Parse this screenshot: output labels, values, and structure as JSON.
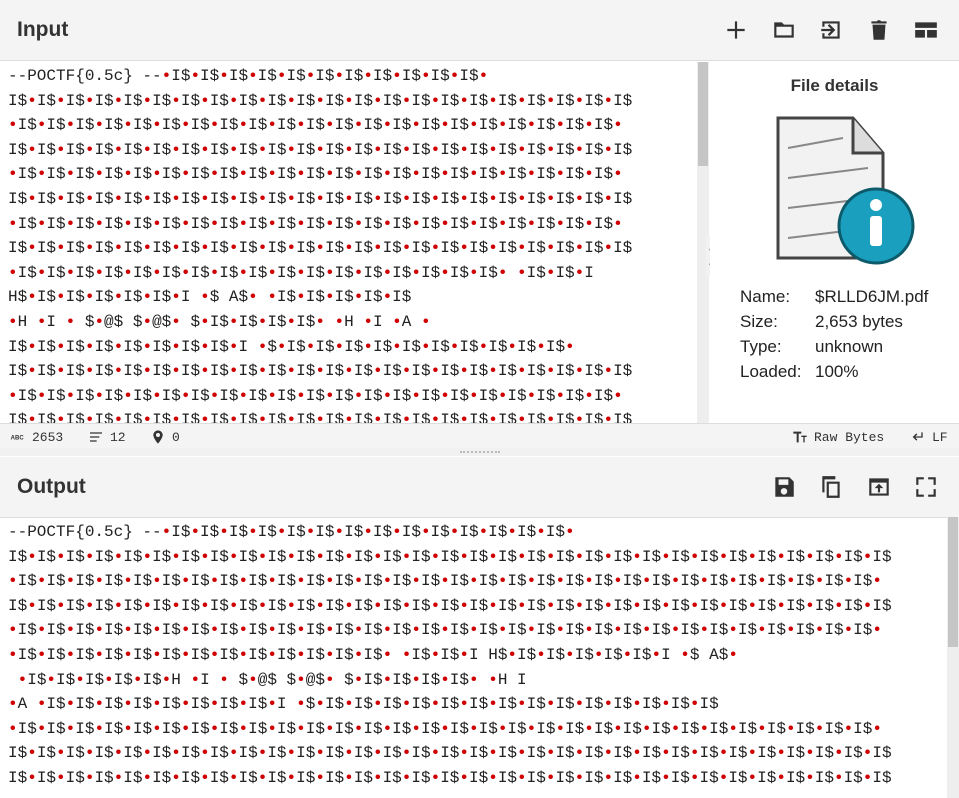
{
  "input": {
    "title": "Input",
    "lines": [
      "--POCTF{0.5c} --•I$•I$•I$•I$•I$•I$•I$•I$•I$•I$•I$•",
      "I$•I$•I$•I$•I$•I$•I$•I$•I$•I$•I$•I$•I$•I$•I$•I$•I$•I$•I$•I$•I$•I$",
      "•I$•I$•I$•I$•I$•I$•I$•I$•I$•I$•I$•I$•I$•I$•I$•I$•I$•I$•I$•I$•I$•",
      "I$•I$•I$•I$•I$•I$•I$•I$•I$•I$•I$•I$•I$•I$•I$•I$•I$•I$•I$•I$•I$•I$",
      "•I$•I$•I$•I$•I$•I$•I$•I$•I$•I$•I$•I$•I$•I$•I$•I$•I$•I$•I$•I$•I$•",
      "I$•I$•I$•I$•I$•I$•I$•I$•I$•I$•I$•I$•I$•I$•I$•I$•I$•I$•I$•I$•I$•I$",
      "•I$•I$•I$•I$•I$•I$•I$•I$•I$•I$•I$•I$•I$•I$•I$•I$•I$•I$•I$•I$•I$•",
      "I$•I$•I$•I$•I$•I$•I$•I$•I$•I$•I$•I$•I$•I$•I$•I$•I$•I$•I$•I$•I$•I$",
      "•I$•I$•I$•I$•I$•I$•I$•I$•I$•I$•I$•I$•I$•I$•I$•I$•I$• •I$•I$•I",
      "H$•I$•I$•I$•I$•I$•I •$ A$• •I$•I$•I$•I$•I$",
      "•H •I • $•@$ $•@$• $•I$•I$•I$•I$• •H •I •A •",
      "I$•I$•I$•I$•I$•I$•I$•I$•I •$•I$•I$•I$•I$•I$•I$•I$•I$•I$•I$•",
      "I$•I$•I$•I$•I$•I$•I$•I$•I$•I$•I$•I$•I$•I$•I$•I$•I$•I$•I$•I$•I$•I$",
      "•I$•I$•I$•I$•I$•I$•I$•I$•I$•I$•I$•I$•I$•I$•I$•I$•I$•I$•I$•I$•I$•",
      "I$•I$•I$•I$•I$•I$•I$•I$•I$•I$•I$•I$•I$•I$•I$•I$•I$•I$•I$•I$•I$•I$"
    ],
    "status": {
      "length": "2653",
      "lines": "12",
      "position": "0",
      "encoding": "Raw Bytes",
      "eol": "LF"
    }
  },
  "file_details": {
    "title": "File details",
    "name_label": "Name:",
    "name_value": "$RLLD6JM.pdf",
    "size_label": "Size:",
    "size_value": "2,653 bytes",
    "type_label": "Type:",
    "type_value": "unknown",
    "loaded_label": "Loaded:",
    "loaded_value": "100%"
  },
  "output": {
    "title": "Output",
    "lines": [
      "--POCTF{0.5c} --•I$•I$•I$•I$•I$•I$•I$•I$•I$•I$•I$•I$•I$•I$•",
      "I$•I$•I$•I$•I$•I$•I$•I$•I$•I$•I$•I$•I$•I$•I$•I$•I$•I$•I$•I$•I$•I$•I$•I$•I$•I$•I$•I$•I$•I$•I$",
      "•I$•I$•I$•I$•I$•I$•I$•I$•I$•I$•I$•I$•I$•I$•I$•I$•I$•I$•I$•I$•I$•I$•I$•I$•I$•I$•I$•I$•I$•I$•",
      "I$•I$•I$•I$•I$•I$•I$•I$•I$•I$•I$•I$•I$•I$•I$•I$•I$•I$•I$•I$•I$•I$•I$•I$•I$•I$•I$•I$•I$•I$•I$",
      "•I$•I$•I$•I$•I$•I$•I$•I$•I$•I$•I$•I$•I$•I$•I$•I$•I$•I$•I$•I$•I$•I$•I$•I$•I$•I$•I$•I$•I$•I$•",
      "•I$•I$•I$•I$•I$•I$•I$•I$•I$•I$•I$•I$•I$• •I$•I$•I H$•I$•I$•I$•I$•I$•I •$ A$•",
      " •I$•I$•I$•I$•I$•H •I • $•@$ $•@$• $•I$•I$•I$•I$• •H I",
      "•A •I$•I$•I$•I$•I$•I$•I$•I$•I •$•I$•I$•I$•I$•I$•I$•I$•I$•I$•I$•I$•I$•I$•I$",
      "•I$•I$•I$•I$•I$•I$•I$•I$•I$•I$•I$•I$•I$•I$•I$•I$•I$•I$•I$•I$•I$•I$•I$•I$•I$•I$•I$•I$•I$•I$•",
      "I$•I$•I$•I$•I$•I$•I$•I$•I$•I$•I$•I$•I$•I$•I$•I$•I$•I$•I$•I$•I$•I$•I$•I$•I$•I$•I$•I$•I$•I$•I$",
      "I$•I$•I$•I$•I$•I$•I$•I$•I$•I$•I$•I$•I$•I$•I$•I$•I$•I$•I$•I$•I$•I$•I$•I$•I$•I$•I$•I$•I$•I$•I$"
    ]
  }
}
